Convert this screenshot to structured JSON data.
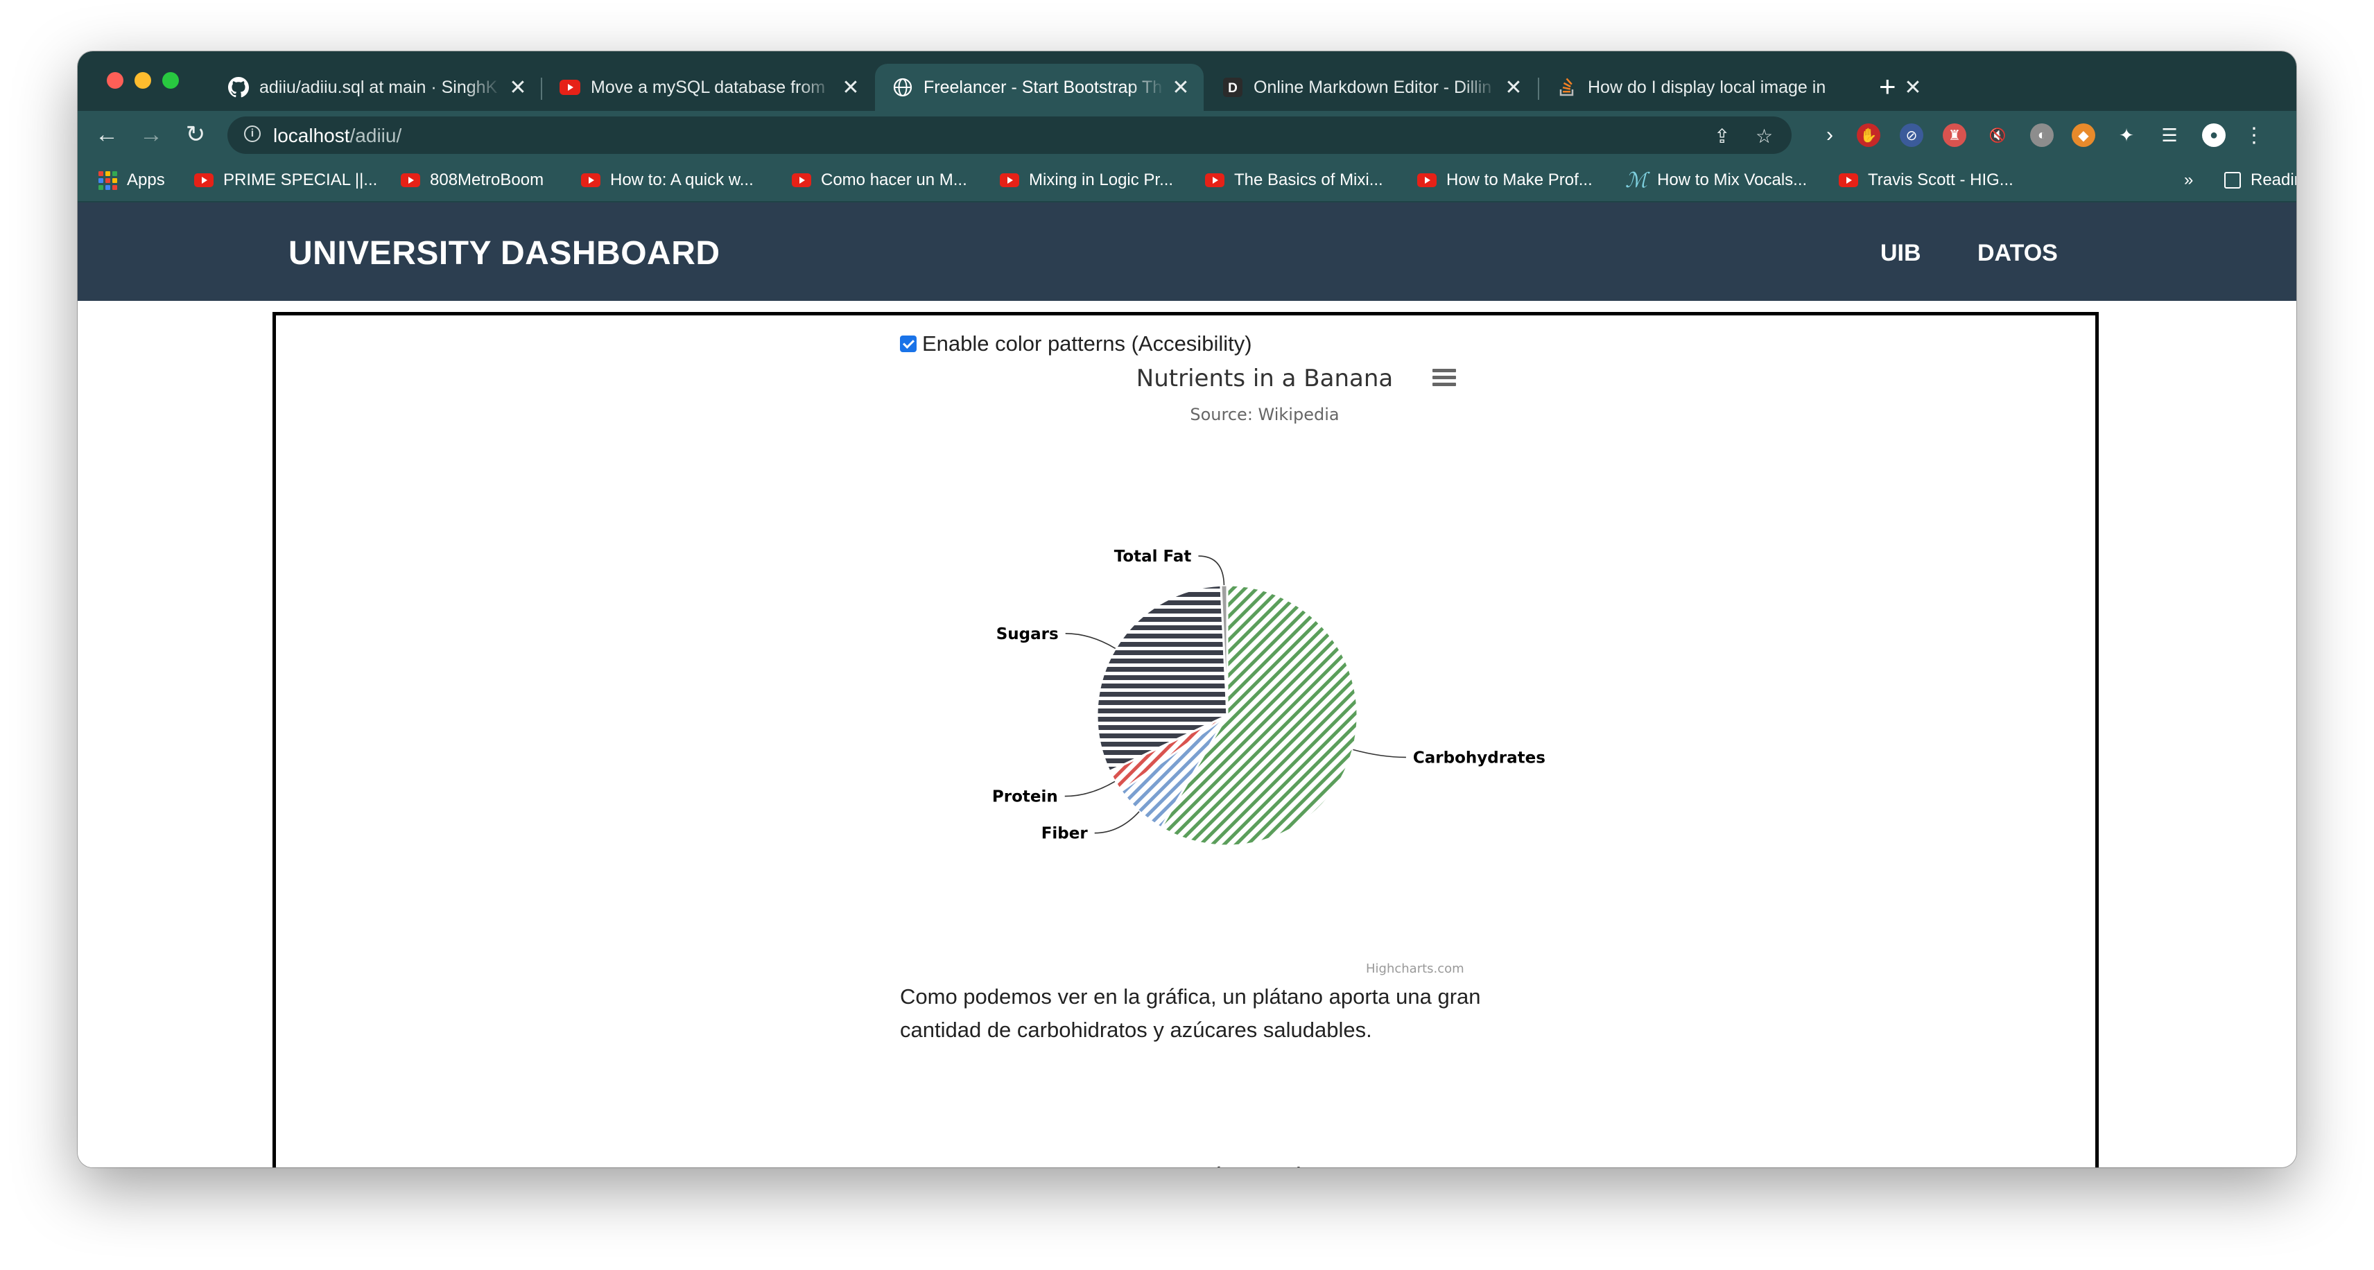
{
  "browser": {
    "tabs": [
      {
        "title": "adiiu/adiiu.sql at main · SinghK",
        "icon": "github-icon"
      },
      {
        "title": "Move a mySQL database from",
        "icon": "youtube-icon"
      },
      {
        "title": "Freelancer - Start Bootstrap Th",
        "icon": "globe-icon",
        "active": true
      },
      {
        "title": "Online Markdown Editor - Dillin",
        "icon": "dillinger-icon"
      },
      {
        "title": "How do I display local image in",
        "icon": "stackoverflow-icon"
      }
    ],
    "url_host": "localhost",
    "url_path": "/adiiu/",
    "bookmarks": [
      {
        "label": "Apps",
        "icon": "apps-icon"
      },
      {
        "label": "PRIME SPECIAL ||...",
        "icon": "youtube-icon"
      },
      {
        "label": "808MetroBoom",
        "icon": "youtube-icon"
      },
      {
        "label": "How to: A quick w...",
        "icon": "youtube-icon"
      },
      {
        "label": "Como hacer un M...",
        "icon": "youtube-icon"
      },
      {
        "label": "Mixing in Logic Pr...",
        "icon": "youtube-icon"
      },
      {
        "label": "The Basics of Mixi...",
        "icon": "youtube-icon"
      },
      {
        "label": "How to Make Prof...",
        "icon": "youtube-icon"
      },
      {
        "label": "How to Mix Vocals...",
        "icon": "music-icon"
      },
      {
        "label": "Travis Scott - HIG...",
        "icon": "youtube-icon"
      }
    ],
    "more_bookmarks": "»",
    "reading_list": "Reading List"
  },
  "page": {
    "brand": "UNIVERSITY DASHBOARD",
    "nav": [
      "UIB",
      "DATOS"
    ],
    "checkbox_label": "Enable color patterns (Accesibility)",
    "checkbox_checked": true,
    "paragraph": "Como podemos ver en la gráfica, un plátano aporta una gran cantidad de carbohidratos y azúcares saludables.",
    "second_chart_title": "Los cincos países más poblados del mundo",
    "credit": "Highcharts.com"
  },
  "chart_data": {
    "type": "pie",
    "title": "Nutrients in a Banana",
    "subtitle": "Source: Wikipedia",
    "categories": [
      "Carbohydrates",
      "Fiber",
      "Protein",
      "Sugars",
      "Total Fat"
    ],
    "values": [
      22.8,
      2.6,
      1.1,
      12.2,
      0.3
    ],
    "colors": [
      "#5b9e5b",
      "#7a9fd0",
      "#d9534f",
      "#3b3f4a",
      "#a0a0a0"
    ],
    "patterns": [
      "diagonal",
      "diagonal",
      "diagonal",
      "horizontal",
      "none"
    ],
    "legend": false
  },
  "colors": {
    "tabstrip": "#1d3a3d",
    "toolbar": "#2a5457",
    "navbar": "#2c3e50"
  }
}
